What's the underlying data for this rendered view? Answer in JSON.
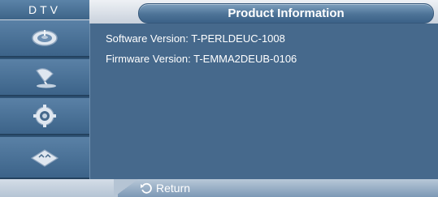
{
  "header": {
    "mode": "DTV",
    "title": "Product Information"
  },
  "sidebar": {
    "items": [
      {
        "icon": "satellite-dish-icon"
      },
      {
        "icon": "antenna-icon"
      },
      {
        "icon": "gear-icon"
      },
      {
        "icon": "remote-icon"
      }
    ]
  },
  "info": {
    "software": "Software Version: T-PERLDEUC-1008",
    "firmware": "Firmware Version: T-EMMA2DEUB-0106"
  },
  "footer": {
    "return_label": "Return",
    "return_icon": "return-icon"
  },
  "colors": {
    "panel": "#46698c",
    "accent": "#4d7397",
    "text": "#ffffff"
  }
}
